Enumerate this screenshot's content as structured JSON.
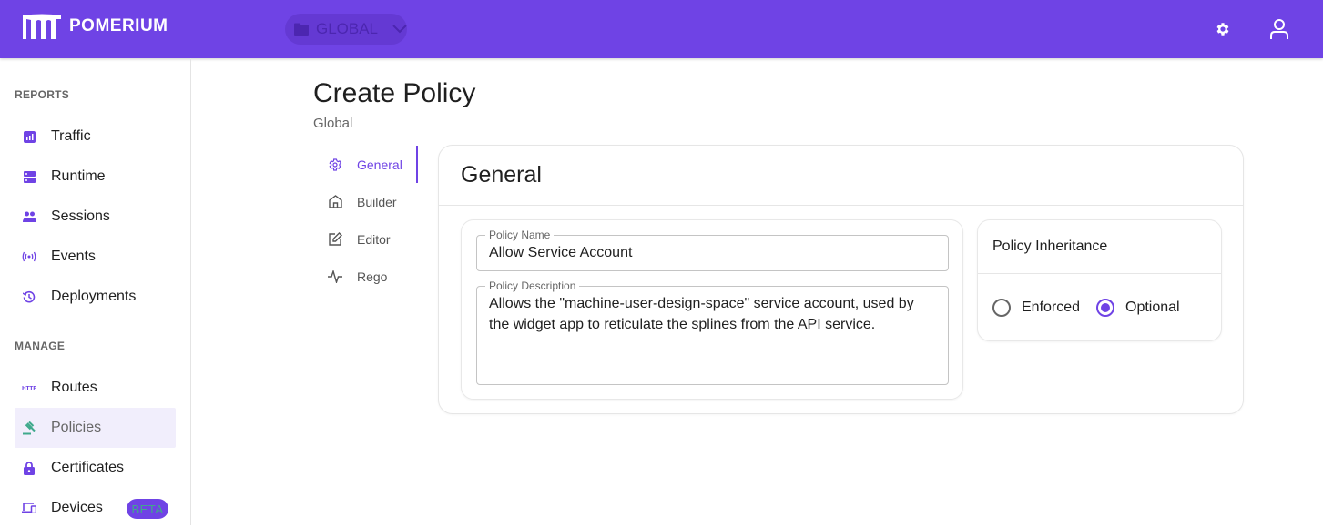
{
  "topbar": {
    "brand": "POMERIUM",
    "namespace_selector": {
      "label": "GLOBAL",
      "icon": "folder-icon"
    },
    "icons": [
      "gear-icon",
      "user-icon"
    ]
  },
  "sidebar": {
    "sections": [
      {
        "title": "REPORTS",
        "items": [
          {
            "label": "Traffic",
            "icon": "bar-chart-icon"
          },
          {
            "label": "Runtime",
            "icon": "server-icon"
          },
          {
            "label": "Sessions",
            "icon": "people-icon"
          },
          {
            "label": "Events",
            "icon": "broadcast-icon"
          },
          {
            "label": "Deployments",
            "icon": "history-icon"
          }
        ]
      },
      {
        "title": "MANAGE",
        "items": [
          {
            "label": "Routes",
            "icon": "http-icon"
          },
          {
            "label": "Policies",
            "icon": "gavel-icon",
            "active": true
          },
          {
            "label": "Certificates",
            "icon": "lock-icon"
          },
          {
            "label": "Devices",
            "icon": "devices-icon",
            "badge": "BETA"
          }
        ]
      }
    ]
  },
  "page": {
    "title": "Create Policy",
    "subtitle": "Global",
    "tabs": [
      {
        "label": "General",
        "icon": "gear-outline-icon",
        "active": true
      },
      {
        "label": "Builder",
        "icon": "home-icon"
      },
      {
        "label": "Editor",
        "icon": "edit-icon"
      },
      {
        "label": "Rego",
        "icon": "pulse-icon"
      }
    ]
  },
  "general": {
    "title": "General",
    "policy_name": {
      "label": "Policy Name",
      "value": "Allow Service Account"
    },
    "policy_description": {
      "label": "Policy Description",
      "value": "Allows the \"machine-user-design-space\" service account, used by the widget app to reticulate the splines from the API service."
    },
    "inheritance": {
      "title": "Policy Inheritance",
      "options": [
        {
          "label": "Enforced",
          "checked": false
        },
        {
          "label": "Optional",
          "checked": true
        }
      ]
    }
  },
  "colors": {
    "brand": "#6f43e5",
    "accent_green": "#3fa98c"
  }
}
